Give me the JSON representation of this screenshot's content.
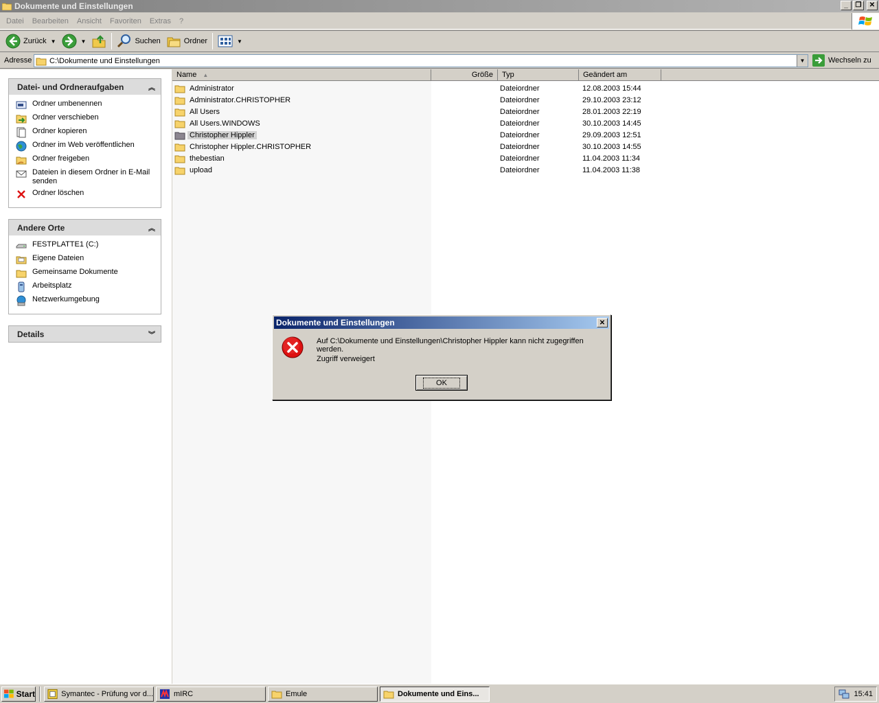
{
  "window": {
    "title": "Dokumente und Einstellungen"
  },
  "menu": [
    "Datei",
    "Bearbeiten",
    "Ansicht",
    "Favoriten",
    "Extras",
    "?"
  ],
  "toolbar": {
    "back": "Zurück",
    "search": "Suchen",
    "folders": "Ordner"
  },
  "address": {
    "label": "Adresse",
    "value": "C:\\Dokumente und Einstellungen",
    "go": "Wechseln zu"
  },
  "taskpane": {
    "file_tasks": {
      "title": "Datei- und Ordneraufgaben",
      "items": [
        {
          "label": "Ordner umbenennen",
          "icon": "rename-icon"
        },
        {
          "label": "Ordner verschieben",
          "icon": "move-icon"
        },
        {
          "label": "Ordner kopieren",
          "icon": "copy-icon"
        },
        {
          "label": "Ordner im Web veröffentlichen",
          "icon": "web-publish-icon"
        },
        {
          "label": "Ordner freigeben",
          "icon": "share-icon"
        },
        {
          "label": "Dateien in diesem Ordner in E-Mail senden",
          "icon": "email-icon"
        },
        {
          "label": "Ordner löschen",
          "icon": "delete-icon"
        }
      ]
    },
    "other_places": {
      "title": "Andere Orte",
      "items": [
        {
          "label": "FESTPLATTE1 (C:)",
          "icon": "drive-icon"
        },
        {
          "label": "Eigene Dateien",
          "icon": "folder-icon"
        },
        {
          "label": "Gemeinsame Dokumente",
          "icon": "folder-icon"
        },
        {
          "label": "Arbeitsplatz",
          "icon": "computer-icon"
        },
        {
          "label": "Netzwerkumgebung",
          "icon": "network-icon"
        }
      ]
    },
    "details": {
      "title": "Details"
    }
  },
  "list": {
    "headers": {
      "name": "Name",
      "size": "Größe",
      "type": "Typ",
      "modified": "Geändert am"
    },
    "rows": [
      {
        "name": "Administrator",
        "type": "Dateiordner",
        "modified": "12.08.2003 15:44"
      },
      {
        "name": "Administrator.CHRISTOPHER",
        "type": "Dateiordner",
        "modified": "29.10.2003 23:12"
      },
      {
        "name": "All Users",
        "type": "Dateiordner",
        "modified": "28.01.2003 22:19"
      },
      {
        "name": "All Users.WINDOWS",
        "type": "Dateiordner",
        "modified": "30.10.2003 14:45"
      },
      {
        "name": "Christopher Hippler",
        "type": "Dateiordner",
        "modified": "29.09.2003 12:51"
      },
      {
        "name": "Christopher Hippler.CHRISTOPHER",
        "type": "Dateiordner",
        "modified": "30.10.2003 14:55"
      },
      {
        "name": "thebestian",
        "type": "Dateiordner",
        "modified": "11.04.2003 11:34"
      },
      {
        "name": "upload",
        "type": "Dateiordner",
        "modified": "11.04.2003 11:38"
      }
    ]
  },
  "dialog": {
    "title": "Dokumente und Einstellungen",
    "message": "Auf C:\\Dokumente und Einstellungen\\Christopher Hippler kann nicht zugegriffen werden.",
    "detail": "Zugriff verweigert",
    "ok": "OK"
  },
  "taskbar": {
    "start": "Start",
    "tasks": [
      {
        "label": "Symantec - Prüfung vor d...",
        "active": false
      },
      {
        "label": "mIRC",
        "active": false
      },
      {
        "label": "Emule",
        "active": false
      },
      {
        "label": "Dokumente und Eins...",
        "active": true
      }
    ],
    "clock": "15:41"
  },
  "colors": {
    "dialog_title": "#0a246a",
    "selected_row": "#d3d3d3",
    "error_red": "#d11"
  }
}
